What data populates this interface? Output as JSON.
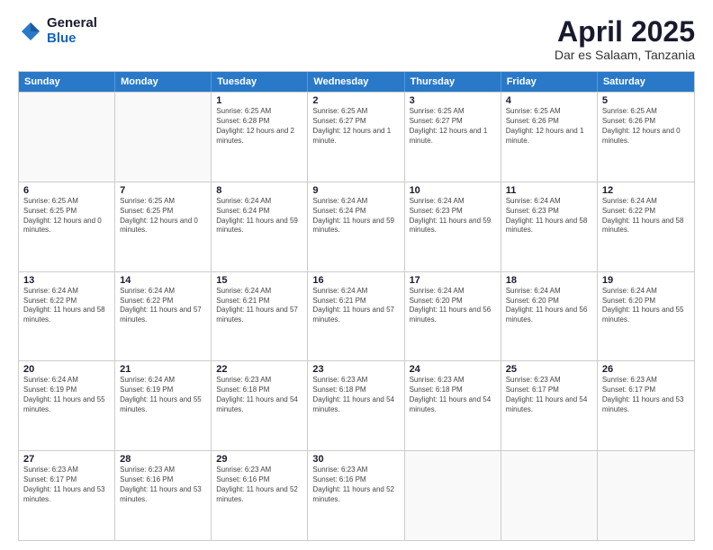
{
  "logo": {
    "general": "General",
    "blue": "Blue"
  },
  "header": {
    "month": "April 2025",
    "location": "Dar es Salaam, Tanzania"
  },
  "weekdays": [
    "Sunday",
    "Monday",
    "Tuesday",
    "Wednesday",
    "Thursday",
    "Friday",
    "Saturday"
  ],
  "weeks": [
    [
      {
        "day": "",
        "info": ""
      },
      {
        "day": "",
        "info": ""
      },
      {
        "day": "1",
        "info": "Sunrise: 6:25 AM\nSunset: 6:28 PM\nDaylight: 12 hours and 2 minutes."
      },
      {
        "day": "2",
        "info": "Sunrise: 6:25 AM\nSunset: 6:27 PM\nDaylight: 12 hours and 1 minute."
      },
      {
        "day": "3",
        "info": "Sunrise: 6:25 AM\nSunset: 6:27 PM\nDaylight: 12 hours and 1 minute."
      },
      {
        "day": "4",
        "info": "Sunrise: 6:25 AM\nSunset: 6:26 PM\nDaylight: 12 hours and 1 minute."
      },
      {
        "day": "5",
        "info": "Sunrise: 6:25 AM\nSunset: 6:26 PM\nDaylight: 12 hours and 0 minutes."
      }
    ],
    [
      {
        "day": "6",
        "info": "Sunrise: 6:25 AM\nSunset: 6:25 PM\nDaylight: 12 hours and 0 minutes."
      },
      {
        "day": "7",
        "info": "Sunrise: 6:25 AM\nSunset: 6:25 PM\nDaylight: 12 hours and 0 minutes."
      },
      {
        "day": "8",
        "info": "Sunrise: 6:24 AM\nSunset: 6:24 PM\nDaylight: 11 hours and 59 minutes."
      },
      {
        "day": "9",
        "info": "Sunrise: 6:24 AM\nSunset: 6:24 PM\nDaylight: 11 hours and 59 minutes."
      },
      {
        "day": "10",
        "info": "Sunrise: 6:24 AM\nSunset: 6:23 PM\nDaylight: 11 hours and 59 minutes."
      },
      {
        "day": "11",
        "info": "Sunrise: 6:24 AM\nSunset: 6:23 PM\nDaylight: 11 hours and 58 minutes."
      },
      {
        "day": "12",
        "info": "Sunrise: 6:24 AM\nSunset: 6:22 PM\nDaylight: 11 hours and 58 minutes."
      }
    ],
    [
      {
        "day": "13",
        "info": "Sunrise: 6:24 AM\nSunset: 6:22 PM\nDaylight: 11 hours and 58 minutes."
      },
      {
        "day": "14",
        "info": "Sunrise: 6:24 AM\nSunset: 6:22 PM\nDaylight: 11 hours and 57 minutes."
      },
      {
        "day": "15",
        "info": "Sunrise: 6:24 AM\nSunset: 6:21 PM\nDaylight: 11 hours and 57 minutes."
      },
      {
        "day": "16",
        "info": "Sunrise: 6:24 AM\nSunset: 6:21 PM\nDaylight: 11 hours and 57 minutes."
      },
      {
        "day": "17",
        "info": "Sunrise: 6:24 AM\nSunset: 6:20 PM\nDaylight: 11 hours and 56 minutes."
      },
      {
        "day": "18",
        "info": "Sunrise: 6:24 AM\nSunset: 6:20 PM\nDaylight: 11 hours and 56 minutes."
      },
      {
        "day": "19",
        "info": "Sunrise: 6:24 AM\nSunset: 6:20 PM\nDaylight: 11 hours and 55 minutes."
      }
    ],
    [
      {
        "day": "20",
        "info": "Sunrise: 6:24 AM\nSunset: 6:19 PM\nDaylight: 11 hours and 55 minutes."
      },
      {
        "day": "21",
        "info": "Sunrise: 6:24 AM\nSunset: 6:19 PM\nDaylight: 11 hours and 55 minutes."
      },
      {
        "day": "22",
        "info": "Sunrise: 6:23 AM\nSunset: 6:18 PM\nDaylight: 11 hours and 54 minutes."
      },
      {
        "day": "23",
        "info": "Sunrise: 6:23 AM\nSunset: 6:18 PM\nDaylight: 11 hours and 54 minutes."
      },
      {
        "day": "24",
        "info": "Sunrise: 6:23 AM\nSunset: 6:18 PM\nDaylight: 11 hours and 54 minutes."
      },
      {
        "day": "25",
        "info": "Sunrise: 6:23 AM\nSunset: 6:17 PM\nDaylight: 11 hours and 54 minutes."
      },
      {
        "day": "26",
        "info": "Sunrise: 6:23 AM\nSunset: 6:17 PM\nDaylight: 11 hours and 53 minutes."
      }
    ],
    [
      {
        "day": "27",
        "info": "Sunrise: 6:23 AM\nSunset: 6:17 PM\nDaylight: 11 hours and 53 minutes."
      },
      {
        "day": "28",
        "info": "Sunrise: 6:23 AM\nSunset: 6:16 PM\nDaylight: 11 hours and 53 minutes."
      },
      {
        "day": "29",
        "info": "Sunrise: 6:23 AM\nSunset: 6:16 PM\nDaylight: 11 hours and 52 minutes."
      },
      {
        "day": "30",
        "info": "Sunrise: 6:23 AM\nSunset: 6:16 PM\nDaylight: 11 hours and 52 minutes."
      },
      {
        "day": "",
        "info": ""
      },
      {
        "day": "",
        "info": ""
      },
      {
        "day": "",
        "info": ""
      }
    ]
  ]
}
